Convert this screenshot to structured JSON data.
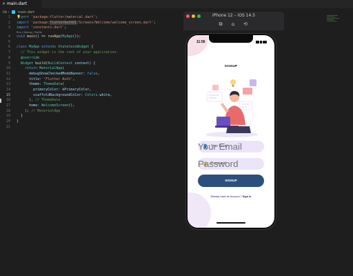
{
  "editor": {
    "tab_label": "main.dart",
    "breadcrumb_path": "lib",
    "breadcrumb_file": "main.dart",
    "code_lens": "Run | Debug | Profile",
    "line_numbers": [
      "1",
      "2",
      "3",
      "",
      "4",
      "5",
      "6",
      "7",
      "8",
      "9",
      "10",
      "11",
      "12",
      "13",
      "14",
      "15",
      "16",
      "17",
      "18",
      "19",
      "20",
      "21"
    ],
    "active_line": "15"
  },
  "simulator": {
    "title": "iPhone 12 – iOS 14.5",
    "tool_icons": [
      "screenshot-icon",
      "home-icon",
      "rotate-icon"
    ],
    "colors": {
      "close": "#ff5f57",
      "minimize": "#febc2e",
      "maximize": "#28c840"
    }
  },
  "app": {
    "status_time": "11:56",
    "title": "SIGNUP",
    "email_placeholder": "Your Email",
    "password_placeholder": "Password",
    "button_label": "SIGNUP",
    "already_text": "Already have an Account ? ",
    "signin_link": "Sign In",
    "colors": {
      "primary": "#2d4f7d",
      "field_bg": "#ece4f9",
      "scaffold": "#ffffff"
    }
  }
}
